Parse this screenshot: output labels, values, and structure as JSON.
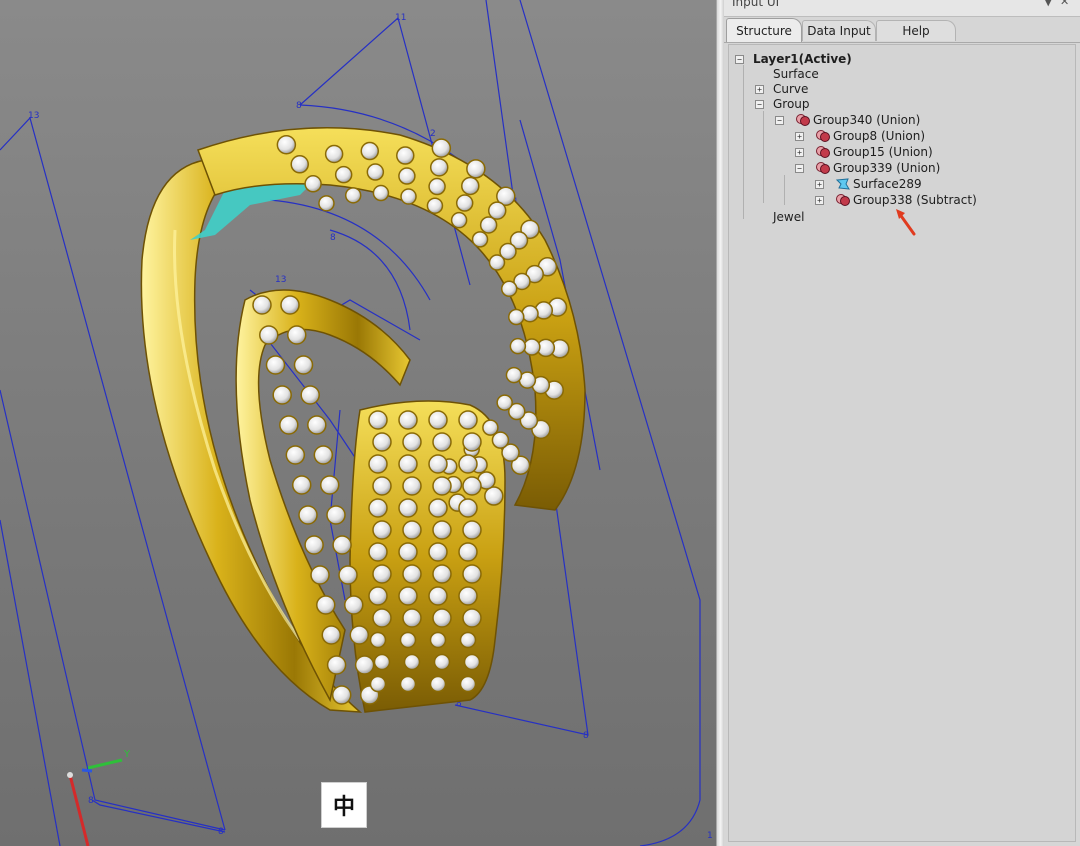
{
  "panel": {
    "title": "Input UI",
    "tabs": [
      {
        "label": "Structure",
        "active": true
      },
      {
        "label": "Data Input",
        "active": false
      },
      {
        "label": "Help",
        "active": false
      }
    ]
  },
  "tree": {
    "layer": "Layer1(Active)",
    "surface": "Surface",
    "curve": "Curve",
    "group": "Group",
    "group340": "Group340 (Union)",
    "group8": "Group8 (Union)",
    "group15": "Group15 (Union)",
    "group339": "Group339 (Union)",
    "surface289": "Surface289",
    "group338": "Group338 (Subtract)",
    "jewel": "Jewel"
  },
  "viewport": {
    "ime_indicator": "中",
    "axis_y_label": "Y",
    "colors": {
      "gold": "#d8b21a",
      "gold_dark": "#8a6a05",
      "cyan": "#3fcfc8",
      "guide_lines": "#2630c4",
      "annotation_arrow": "#e03b1f"
    }
  }
}
